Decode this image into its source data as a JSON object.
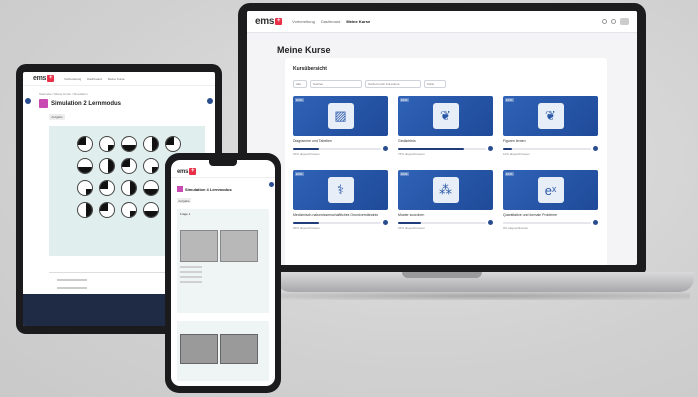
{
  "laptop": {
    "logo": "ems",
    "logo_cross": "+",
    "nav_links": [
      "Vorbereitung",
      "Dashboard",
      "Meine Kurse"
    ],
    "page_title": "Meine Kurse",
    "panel_title": "Kursübersicht",
    "filters": [
      "Alle",
      "Suchen",
      "Sortiert nach Kursname",
      "Karte"
    ],
    "courses": [
      {
        "badge": "EMS",
        "icon": "stripes-icon",
        "glyph": "▨",
        "name": "Diagramme und Tabellen",
        "status": "30% abgeschlossen",
        "progress": 0.3
      },
      {
        "badge": "EMS",
        "icon": "brain-icon",
        "glyph": "❦",
        "name": "Gedächtnis",
        "status": "75% abgeschlossen",
        "progress": 0.75
      },
      {
        "badge": "EMS",
        "icon": "brain-icon",
        "glyph": "❦",
        "name": "Figuren lernen",
        "status": "10% abgeschlossen",
        "progress": 0.1
      },
      {
        "badge": "EMS",
        "icon": "dna-icon",
        "glyph": "⚕",
        "name": "Medizinisch-naturwissenschaftliches Grundverständnis",
        "status": "30% abgeschlossen",
        "progress": 0.3
      },
      {
        "badge": "EMS",
        "icon": "molecule-icon",
        "glyph": "⁂",
        "name": "Muster zuordnen",
        "status": "26% abgeschlossen",
        "progress": 0.26
      },
      {
        "badge": "EMS",
        "icon": "exponent-icon",
        "glyph": "eˣ",
        "name": "Quantitative und formale Probleme",
        "status": "0% abgeschlossen",
        "progress": 0.0
      }
    ]
  },
  "tablet": {
    "logo": "ems",
    "nav_links": [
      "Vorbereitung",
      "Dashboard",
      "Meine Kurse"
    ],
    "breadcrumb": "Startseite / Meine Kurse / Simulation",
    "heading": "Simulation 2 Lernmodus",
    "chip": "Aufgabe"
  },
  "phone": {
    "logo": "ems",
    "heading": "Simulation 4 Lernmodus",
    "chip": "Aufgabe",
    "question_label": "Frage 1"
  }
}
